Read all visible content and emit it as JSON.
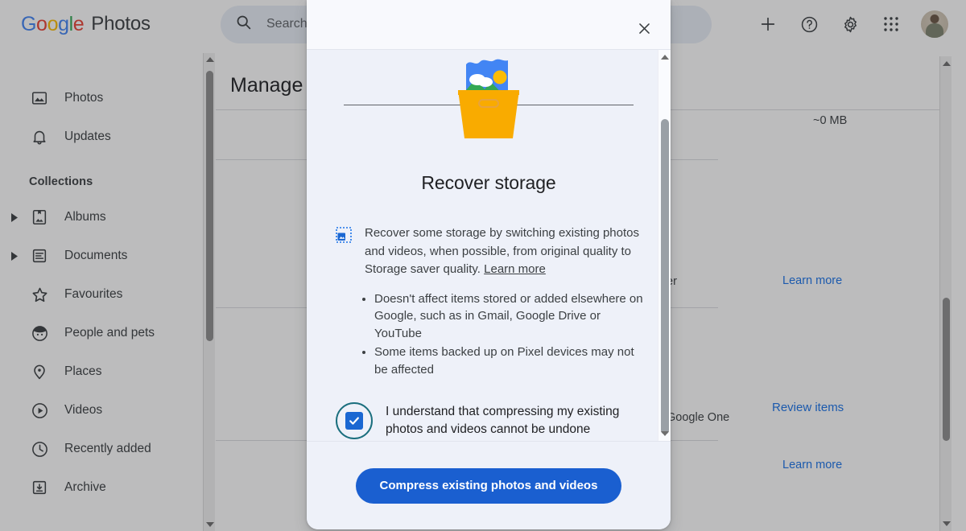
{
  "header": {
    "logo_word": "Google",
    "brand_name": "Photos",
    "search_placeholder": "Search",
    "icons": {
      "search": "search-icon",
      "add": "plus-icon",
      "help": "help-icon",
      "settings": "gear-icon",
      "apps": "apps-grid-icon",
      "account": "avatar"
    }
  },
  "sidebar": {
    "section_label": "Collections",
    "items": [
      {
        "label": "Photos",
        "icon": "photo-icon",
        "expandable": false
      },
      {
        "label": "Updates",
        "icon": "bell-icon",
        "expandable": false
      },
      {
        "label": "Albums",
        "icon": "album-icon",
        "expandable": true
      },
      {
        "label": "Documents",
        "icon": "document-icon",
        "expandable": true
      },
      {
        "label": "Favourites",
        "icon": "star-icon",
        "expandable": false
      },
      {
        "label": "People and pets",
        "icon": "face-icon",
        "expandable": false
      },
      {
        "label": "Places",
        "icon": "location-pin-icon",
        "expandable": false
      },
      {
        "label": "Videos",
        "icon": "play-circle-icon",
        "expandable": false
      },
      {
        "label": "Recently added",
        "icon": "clock-icon",
        "expandable": false
      },
      {
        "label": "Archive",
        "icon": "archive-icon",
        "expandable": false
      }
    ]
  },
  "main": {
    "title": "Manage",
    "rows": [
      {
        "size": "~0 MB"
      },
      {
        "link": "Learn more"
      },
      {
        "text": "er",
        "link": "Learn more"
      },
      {
        "text": "Google One",
        "link": "Review items"
      },
      {
        "link": "Learn more"
      }
    ]
  },
  "dialog": {
    "close_label": "Close",
    "title": "Recover storage",
    "illustration": "storage-box-photo-illustration",
    "body_icon": "compress-image-icon",
    "paragraph": "Recover some storage by switching existing photos and videos, when possible, from original quality to Storage saver quality. ",
    "paragraph_link": "Learn more",
    "bullets": [
      "Doesn't affect items stored or added elsewhere on Google, such as in Gmail, Google Drive or YouTube",
      "Some items backed up on Pixel devices may not be affected"
    ],
    "checkbox_label": "I understand that compressing my existing photos and videos cannot be undone",
    "checkbox_checked": true,
    "primary_button": "Compress existing photos and videos"
  },
  "colors": {
    "accent_blue": "#1a5fd0",
    "link_blue": "#1a73e8",
    "checkbox_blue": "#1a67d2",
    "focus_ring": "#1b6f7e",
    "dialog_bg": "#eef1f9",
    "illus_yellow": "#f9ab00",
    "illus_blue": "#4285F4",
    "illus_green": "#34A853"
  }
}
